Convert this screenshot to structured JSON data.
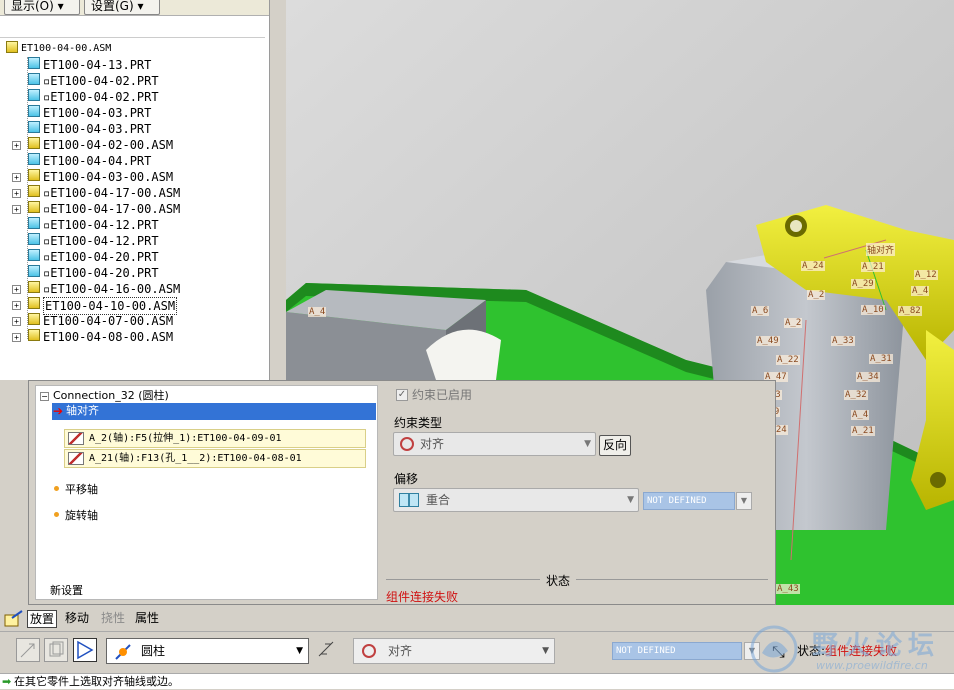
{
  "tree_toolbar": {
    "display_label": "显示(O) ▾",
    "settings_label": "设置(G) ▾"
  },
  "model_tree": {
    "root": "ET100-04-00.ASM",
    "items": [
      {
        "label": "ET100-04-13.PRT",
        "type": "part",
        "expand": false
      },
      {
        "label": "▫ET100-04-02.PRT",
        "type": "part",
        "expand": false
      },
      {
        "label": "▫ET100-04-02.PRT",
        "type": "part",
        "expand": false
      },
      {
        "label": "ET100-04-03.PRT",
        "type": "part",
        "expand": false
      },
      {
        "label": "ET100-04-03.PRT",
        "type": "part",
        "expand": false
      },
      {
        "label": "ET100-04-02-00.ASM",
        "type": "asm",
        "expand": true
      },
      {
        "label": "ET100-04-04.PRT",
        "type": "part",
        "expand": false
      },
      {
        "label": "ET100-04-03-00.ASM",
        "type": "asm",
        "expand": true
      },
      {
        "label": "▫ET100-04-17-00.ASM",
        "type": "asm",
        "expand": true
      },
      {
        "label": "▫ET100-04-17-00.ASM",
        "type": "asm",
        "expand": true
      },
      {
        "label": "▫ET100-04-12.PRT",
        "type": "part",
        "expand": false
      },
      {
        "label": "▫ET100-04-12.PRT",
        "type": "part",
        "expand": false
      },
      {
        "label": "▫ET100-04-20.PRT",
        "type": "part",
        "expand": false
      },
      {
        "label": "▫ET100-04-20.PRT",
        "type": "part",
        "expand": false
      },
      {
        "label": "▫ET100-04-16-00.ASM",
        "type": "asm",
        "expand": true
      },
      {
        "label": "ET100-04-10-00.ASM",
        "type": "asm",
        "expand": true,
        "selected": true
      },
      {
        "label": "ET100-04-07-00.ASM",
        "type": "asm",
        "expand": true
      },
      {
        "label": "ET100-04-08-00.ASM",
        "type": "asm",
        "expand": true
      }
    ]
  },
  "viewport": {
    "datum_labels": [
      "A_4",
      "A_24",
      "A_21",
      "A_12",
      "A_4",
      "A_29",
      "A_2",
      "A_6",
      "A_82",
      "A_10",
      "A_2",
      "A_49",
      "A_33",
      "A_31",
      "A_22",
      "A_47",
      "A_34",
      "A_23",
      "A_32",
      "A_9",
      "A_4",
      "A_24",
      "A_21",
      "A_43",
      "轴对齐"
    ]
  },
  "dialog": {
    "connection_title": "Connection_32 (圆柱)",
    "axis_align": "轴对齐",
    "refs": [
      "A_2(轴):F5(拉伸_1):ET100-04-09-01",
      "A_21(轴):F13(孔_1__2):ET100-04-08-01"
    ],
    "translate_axis": "平移轴",
    "rotate_axis": "旋转轴",
    "new_set": "新设置",
    "constraint_enabled": "约束已启用",
    "constraint_type_label": "约束类型",
    "constraint_type_value": "对齐",
    "flip_button": "反向",
    "offset_label": "偏移",
    "offset_value": "重合",
    "not_defined": "NOT DEFINED",
    "status_label": "状态",
    "status_message": "组件连接失败"
  },
  "tabs": {
    "placement": "放置",
    "move": "移动",
    "flexibility": "挠性",
    "properties": "属性"
  },
  "dashboard": {
    "connection_type": "圆柱",
    "constraint_type": "对齐",
    "not_defined": "NOT DEFINED",
    "status_prefix": "状态:",
    "status_value": "组件连接失败"
  },
  "message_bar": "在其它零件上选取对齐轴线或边。",
  "watermark": {
    "text": "野火论坛",
    "url": "www.proewildfire.cn"
  },
  "colors": {
    "selection_blue": "#3373d6",
    "error_red": "#d01010",
    "ref_yellow": "#fffbd8",
    "part_yellow": "#e4e000",
    "base_green": "#2fc22f"
  }
}
